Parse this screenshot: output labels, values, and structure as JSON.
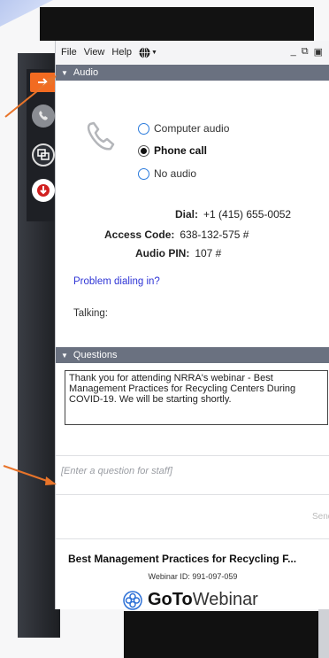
{
  "menubar": {
    "file": "File",
    "view": "View",
    "help": "Help"
  },
  "audio": {
    "section_title": "Audio",
    "options": [
      {
        "label": "Computer audio",
        "selected": false
      },
      {
        "label": "Phone call",
        "selected": true
      },
      {
        "label": "No audio",
        "selected": false
      }
    ],
    "dial_label": "Dial:",
    "dial_value": "+1 (415) 655-0052",
    "access_code_label": "Access Code:",
    "access_code_value": "638-132-575 #",
    "audio_pin_label": "Audio PIN:",
    "audio_pin_value": "107 #",
    "problem_link": "Problem dialing in?",
    "talking_label": "Talking:"
  },
  "questions": {
    "section_title": "Questions",
    "message": "Thank you for attending NRRA's webinar - Best Management Practices for Recycling Centers During COVID-19. We will be starting shortly.",
    "input_placeholder": "[Enter a question for staff]",
    "send_label": "Send"
  },
  "footer": {
    "webinar_title": "Best Management Practices for Recycling F...",
    "webinar_id": "Webinar ID: 991-097-059",
    "brand_bold": "GoTo",
    "brand_rest": "Webinar"
  },
  "colors": {
    "accent_orange": "#f26b21",
    "section_header": "#6a7180",
    "link_blue": "#2f35d6"
  }
}
